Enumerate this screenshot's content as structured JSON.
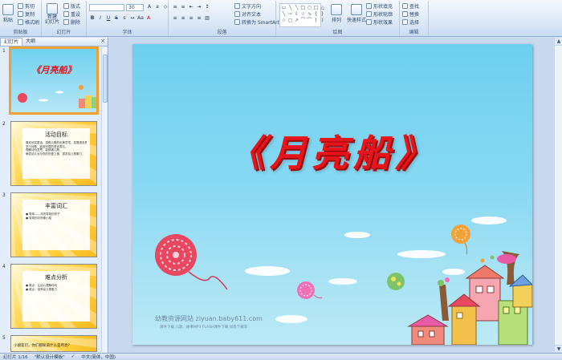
{
  "ribbon": {
    "clipboard": {
      "label": "剪贴板",
      "paste": "粘贴",
      "cut": "剪切",
      "copy": "复制",
      "format_painter": "格式刷"
    },
    "slides": {
      "label": "幻灯片",
      "new_slide": "新建\n幻灯片",
      "layout": "版式",
      "reset": "重设",
      "delete": "删除"
    },
    "font": {
      "label": "字体",
      "size": "30"
    },
    "paragraph": {
      "label": "段落",
      "text_direction": "文字方向",
      "align_text": "对齐文本",
      "smartart": "转换为 SmartArt"
    },
    "drawing": {
      "label": "绘图",
      "arrange": "排列",
      "quick_styles": "快速样式",
      "shape_fill": "形状填充",
      "shape_outline": "形状轮廓",
      "shape_effects": "形状效果"
    },
    "editing": {
      "label": "编辑",
      "find": "查找",
      "replace": "替换",
      "select": "选择"
    }
  },
  "panel": {
    "tab_slides": "幻灯片",
    "tab_outline": "大纲",
    "close": "×"
  },
  "thumbnails": [
    {
      "num": "1",
      "title": "《月亮船》"
    },
    {
      "num": "2",
      "title": "活动目标",
      "lines": [
        "喜欢欣赏童话，感受儿歌的优美意境，发展语言表达能力",
        "学习诗歌，能用完整的语言表达。",
        "理解诗句意思，能朗诵儿歌。",
        "萌发幼儿对月亮的热爱之情，激发幼儿想象力。"
      ]
    },
    {
      "num": "3",
      "title": "丰富词汇",
      "lines": [
        "● 弯弯——月亮弯弯的样子",
        "● 弯弯的月亮像小船"
      ]
    },
    {
      "num": "4",
      "title": "难点分析",
      "lines": [
        "● 难点：让幼儿理解诗句",
        "● 难点：培养幼儿想象力"
      ]
    },
    {
      "num": "5",
      "title": "小朋友们，你们都知道什么是月亮？"
    }
  ],
  "slide": {
    "title": "《月亮船》",
    "watermark": "幼教资源网站  ziyuan.baby611.com",
    "watermark_sub": "课件下载  儿歌、故事MP3  FLASH课件下载  试卷下载等"
  },
  "status": {
    "slide_info": "幻灯片 1/16",
    "theme": "\"默认设计模板\"",
    "language": "中文(简体，中国)"
  }
}
